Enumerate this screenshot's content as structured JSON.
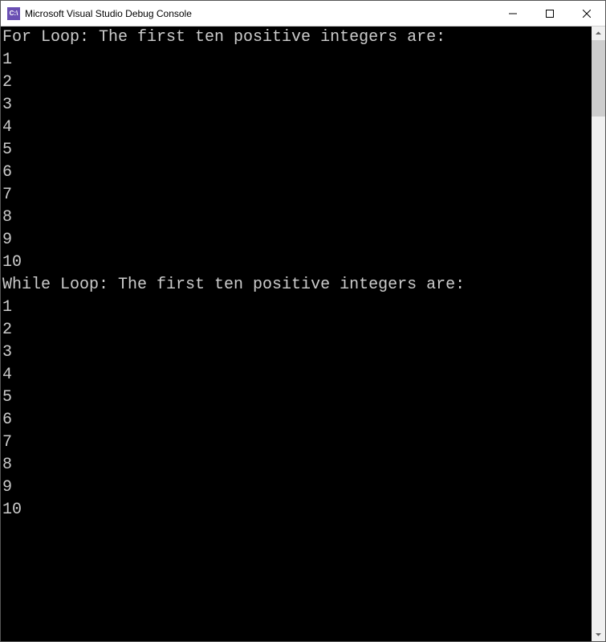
{
  "window": {
    "title": "Microsoft Visual Studio Debug Console",
    "icon_label": "C:\\"
  },
  "console": {
    "lines": [
      "For Loop: The first ten positive integers are:",
      "1",
      "2",
      "3",
      "4",
      "5",
      "6",
      "7",
      "8",
      "9",
      "10",
      "",
      "",
      "While Loop: The first ten positive integers are:",
      "1",
      "2",
      "3",
      "4",
      "5",
      "6",
      "7",
      "8",
      "9",
      "10"
    ]
  }
}
